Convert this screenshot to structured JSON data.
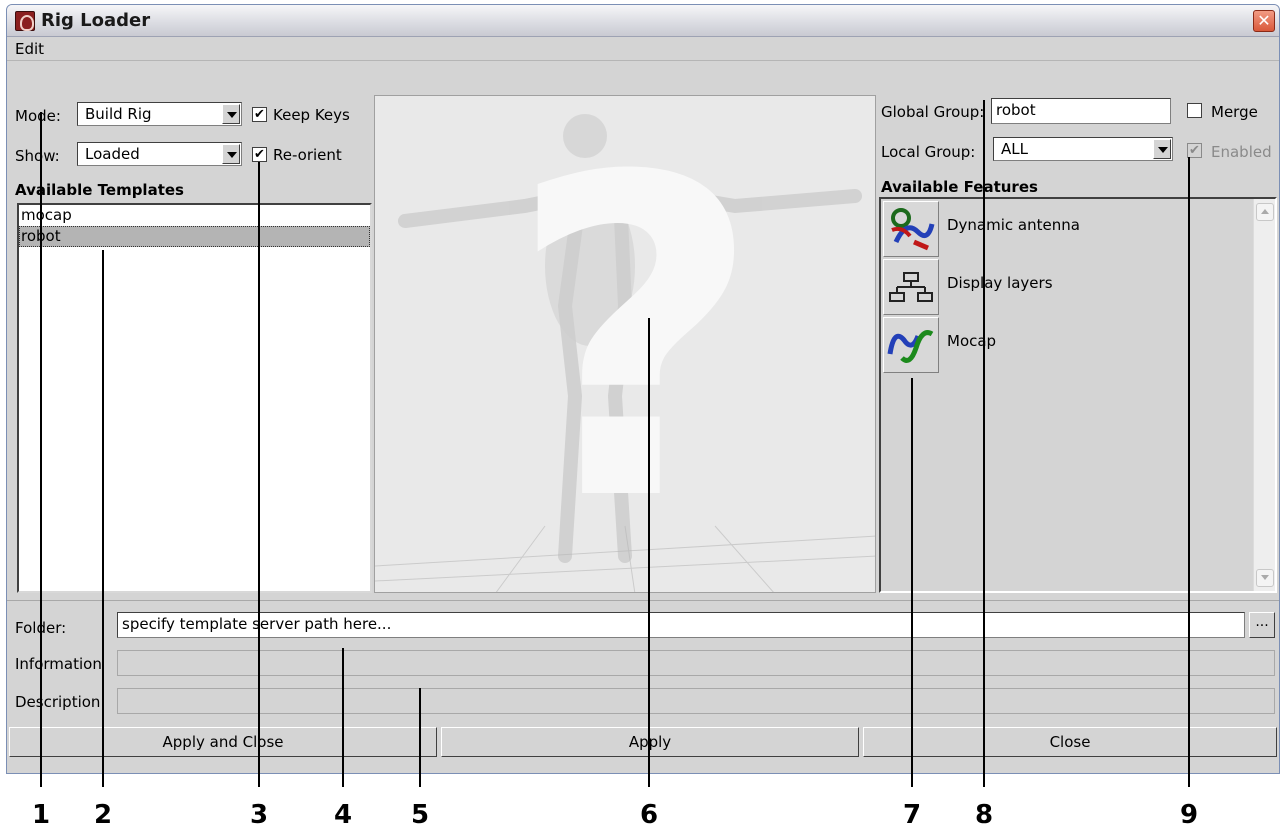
{
  "window": {
    "title": "Rig Loader",
    "close_glyph": "✕"
  },
  "menu": {
    "edit": "Edit"
  },
  "mode": {
    "label": "Mode:",
    "value": "Build Rig"
  },
  "show": {
    "label": "Show:",
    "value": "Loaded"
  },
  "keep_keys": {
    "label": "Keep Keys",
    "checked": true
  },
  "re_orient": {
    "label": "Re-orient",
    "checked": true
  },
  "check_glyph": "✔",
  "templates": {
    "heading": "Available Templates",
    "items": [
      "mocap",
      "robot"
    ],
    "selected": "robot"
  },
  "preview": {
    "glyph": "?"
  },
  "global_group": {
    "label": "Global Group:",
    "value": "robot"
  },
  "merge": {
    "label": "Merge",
    "checked": false
  },
  "local_group": {
    "label": "Local Group:",
    "value": "ALL"
  },
  "enabled": {
    "label": "Enabled",
    "checked": true,
    "disabled": true
  },
  "features": {
    "heading": "Available Features",
    "items": [
      {
        "label": "Dynamic antenna",
        "icon": "dynamic-antenna-icon"
      },
      {
        "label": "Display layers",
        "icon": "display-layers-icon"
      },
      {
        "label": "Mocap",
        "icon": "mocap-icon"
      }
    ]
  },
  "folder": {
    "label": "Folder:",
    "value": "specify template server path here...",
    "browse": "..."
  },
  "information": {
    "label": "Information",
    "value": ""
  },
  "description": {
    "label": "Description",
    "value": ""
  },
  "buttons": {
    "apply_close": "Apply and Close",
    "apply": "Apply",
    "close": "Close"
  },
  "callouts": [
    "1",
    "2",
    "3",
    "4",
    "5",
    "6",
    "7",
    "8",
    "9"
  ]
}
